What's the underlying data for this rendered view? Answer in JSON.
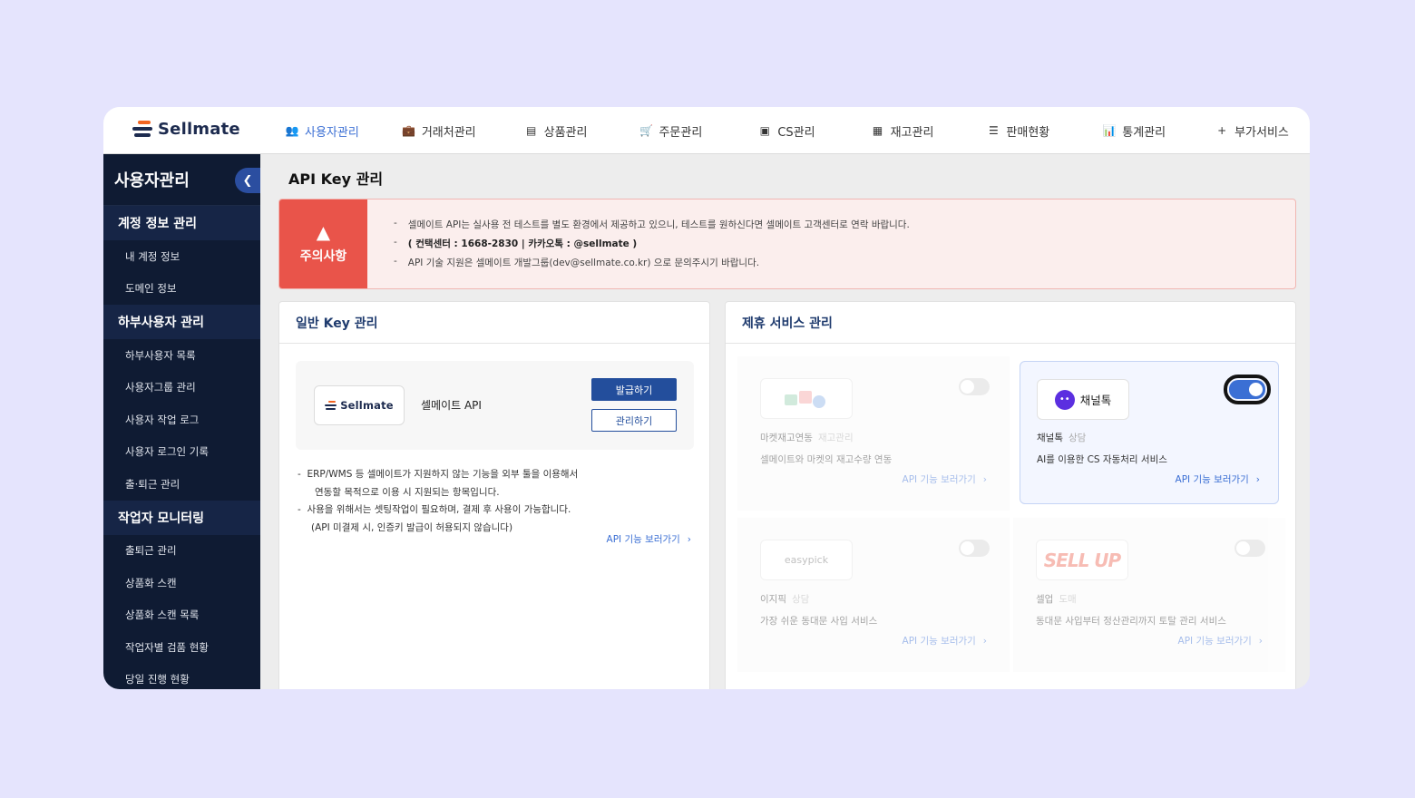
{
  "brand": {
    "logo_text": "Sellmate"
  },
  "nav": [
    {
      "icon": "users-icon",
      "glyph": "👥",
      "label": "사용자관리",
      "active": true
    },
    {
      "icon": "briefcase-icon",
      "glyph": "💼",
      "label": "거래처관리"
    },
    {
      "icon": "box-icon",
      "glyph": "▤",
      "label": "상품관리"
    },
    {
      "icon": "cart-icon",
      "glyph": "🛒",
      "label": "주문관리"
    },
    {
      "icon": "chat-icon",
      "glyph": "▣",
      "label": "CS관리"
    },
    {
      "icon": "boxes-icon",
      "glyph": "▦",
      "label": "재고관리"
    },
    {
      "icon": "list-icon",
      "glyph": "☰",
      "label": "판매현황"
    },
    {
      "icon": "chart-icon",
      "glyph": "📊",
      "label": "통계관리"
    },
    {
      "icon": "plus-icon",
      "glyph": "+",
      "label": "부가서비스"
    }
  ],
  "sidebar": {
    "title": "사용자관리",
    "groups": [
      {
        "label": "계정 정보 관리",
        "items": [
          "내 계정 정보",
          "도메인 정보"
        ]
      },
      {
        "label": "하부사용자 관리",
        "items": [
          "하부사용자 목록",
          "사용자그룹 관리",
          "사용자 작업 로그",
          "사용자 로그인 기록",
          "출·퇴근 관리"
        ]
      },
      {
        "label": "작업자 모니터링",
        "items": [
          "출퇴근 관리",
          "상품화 스캔",
          "상품화 스캔 목록",
          "작업자별 검품 현황",
          "당일 진행 현황"
        ]
      }
    ]
  },
  "page": {
    "title": "API Key 관리"
  },
  "notice": {
    "label": "주의사항",
    "lines": [
      "셀메이트 API는 실사용 전 테스트를 별도 환경에서 제공하고 있으니, 테스트를 원하신다면 셀메이트 고객센터로 연락 바랍니다.",
      "( 컨택센터 : 1668-2830 | 카카오톡 : @sellmate )",
      "API 기술 지원은 셀메이트 개발그룹(dev@sellmate.co.kr) 으로 문의주시기 바랍니다."
    ]
  },
  "general": {
    "title": "일반 Key 관리",
    "key_name": "셀메이트 API",
    "issue_label": "발급하기",
    "manage_label": "관리하기",
    "desc": [
      "ERP/WMS 등 셀메이트가 지원하지 않는 기능을 외부 툴을 이용해서",
      "연동할 목적으로 이용 시 지원되는 항목입니다.",
      "사용을 위해서는 셋팅작업이 필요하며, 결제 후 사용이 가능합니다.",
      "(API 미결제 시, 인증키 발급이 허용되지 않습니다)"
    ],
    "link": "API 기능 보러가기"
  },
  "partner": {
    "title": "제휴 서비스 관리",
    "services": [
      {
        "name": "마켓재고연동",
        "tag": "재고관리",
        "desc": "셀메이트와 마켓의 재고수량 연동",
        "link": "API 기능 보러가기",
        "enabled": false,
        "logo_text": ""
      },
      {
        "name": "채널톡",
        "tag": "상담",
        "desc": "AI를 이용한 CS 자동처리 서비스",
        "link": "API 기능 보러가기",
        "enabled": true,
        "logo_text": "채널톡"
      },
      {
        "name": "이지픽",
        "tag": "상담",
        "desc": "가장 쉬운 동대문 사입 서비스",
        "link": "API 기능 보러가기",
        "enabled": false,
        "logo_text": "easypick"
      },
      {
        "name": "셀업",
        "tag": "도매",
        "desc": "동대문 사입부터 정산관리까지 토탈 관리 서비스",
        "link": "API 기능 보러가기",
        "enabled": false,
        "logo_text": "SELL UP"
      }
    ]
  },
  "colors": {
    "accent": "#3b6fd4",
    "sidebar": "#0f1b33",
    "warning": "#e9544a",
    "primary_button": "#234e9c"
  }
}
